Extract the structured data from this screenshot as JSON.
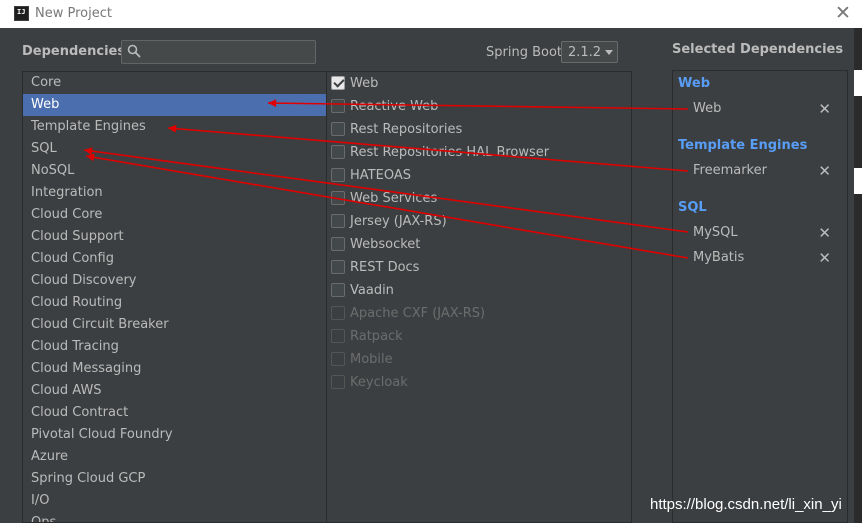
{
  "window": {
    "title": "New Project",
    "close_glyph": "✕",
    "icon_text": "IJ"
  },
  "header": {
    "dependencies_label": "Dependencies",
    "search_placeholder": "",
    "spring_boot_label": "Spring Boot",
    "spring_boot_version": "2.1.2"
  },
  "categories": {
    "selected": "Web",
    "items": [
      "Core",
      "Web",
      "Template Engines",
      "SQL",
      "NoSQL",
      "Integration",
      "Cloud Core",
      "Cloud Support",
      "Cloud Config",
      "Cloud Discovery",
      "Cloud Routing",
      "Cloud Circuit Breaker",
      "Cloud Tracing",
      "Cloud Messaging",
      "Cloud AWS",
      "Cloud Contract",
      "Pivotal Cloud Foundry",
      "Azure",
      "Spring Cloud GCP",
      "I/O",
      "Ops"
    ]
  },
  "dependencies": [
    {
      "label": "Web",
      "checked": true,
      "enabled": true
    },
    {
      "label": "Reactive Web",
      "checked": false,
      "enabled": true
    },
    {
      "label": "Rest Repositories",
      "checked": false,
      "enabled": true
    },
    {
      "label": "Rest Repositories HAL Browser",
      "checked": false,
      "enabled": true
    },
    {
      "label": "HATEOAS",
      "checked": false,
      "enabled": true
    },
    {
      "label": "Web Services",
      "checked": false,
      "enabled": true
    },
    {
      "label": "Jersey (JAX-RS)",
      "checked": false,
      "enabled": true
    },
    {
      "label": "Websocket",
      "checked": false,
      "enabled": true
    },
    {
      "label": "REST Docs",
      "checked": false,
      "enabled": true
    },
    {
      "label": "Vaadin",
      "checked": false,
      "enabled": true
    },
    {
      "label": "Apache CXF (JAX-RS)",
      "checked": false,
      "enabled": false
    },
    {
      "label": "Ratpack",
      "checked": false,
      "enabled": false
    },
    {
      "label": "Mobile",
      "checked": false,
      "enabled": false
    },
    {
      "label": "Keycloak",
      "checked": false,
      "enabled": false
    }
  ],
  "selected_dependencies": {
    "title": "Selected Dependencies",
    "groups": [
      {
        "name": "Web",
        "items": [
          "Web"
        ]
      },
      {
        "name": "Template Engines",
        "items": [
          "Freemarker"
        ]
      },
      {
        "name": "SQL",
        "items": [
          "MySQL",
          "MyBatis"
        ]
      }
    ],
    "remove_glyph": "✕"
  },
  "annotations": {
    "arrow_color": "#e00000"
  },
  "watermark": "https://blog.csdn.net/li_xin_yi",
  "colors": {
    "background": "#3c3f41",
    "selection": "#4b6eaf",
    "group_heading": "#589df6",
    "text": "#bbbbbb"
  },
  "icons": {
    "search": "search-icon",
    "dropdown": "chevron-down-icon",
    "remove": "remove-icon",
    "close": "close-icon"
  }
}
